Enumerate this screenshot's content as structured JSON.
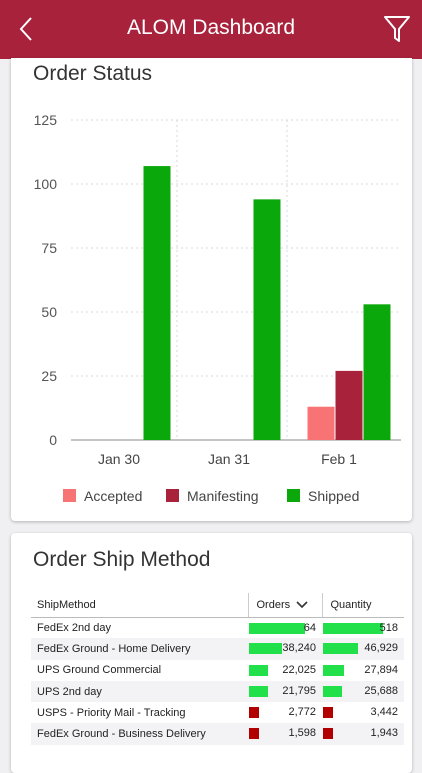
{
  "header": {
    "title": "ALOM Dashboard"
  },
  "order_status": {
    "title": "Order Status"
  },
  "ship_method": {
    "title": "Order Ship Method",
    "columns": [
      "ShipMethod",
      "Orders",
      "Quantity"
    ],
    "rows": [
      {
        "method": "FedEx 2nd day",
        "orders": "64",
        "quantity": "518",
        "orders_val": 64000,
        "qty_val": 80000
      },
      {
        "method": "FedEx Ground - Home Delivery",
        "orders": "38,240",
        "quantity": "46,929",
        "orders_val": 38240,
        "qty_val": 46929
      },
      {
        "method": "UPS Ground Commercial",
        "orders": "22,025",
        "quantity": "27,894",
        "orders_val": 22025,
        "qty_val": 27894
      },
      {
        "method": "UPS 2nd day",
        "orders": "21,795",
        "quantity": "25,688",
        "orders_val": 21795,
        "qty_val": 25688
      },
      {
        "method": "USPS - Priority Mail - Tracking",
        "orders": "2,772",
        "quantity": "3,442",
        "orders_val": 2772,
        "qty_val": 3442
      },
      {
        "method": "FedEx Ground - Business Delivery",
        "orders": "1,598",
        "quantity": "1,943",
        "orders_val": 1598,
        "qty_val": 1943
      }
    ]
  },
  "colors": {
    "header": "#a8223c",
    "accepted": "#f87474",
    "manifesting": "#a8223c",
    "shipped": "#0aa80a",
    "bar_green": "#22e04a",
    "bar_red": "#b20000"
  },
  "chart_data": {
    "type": "bar",
    "categories": [
      "Jan 30",
      "Jan 31",
      "Feb 1"
    ],
    "series": [
      {
        "name": "Accepted",
        "values": [
          0,
          0,
          13
        ]
      },
      {
        "name": "Manifesting",
        "values": [
          0,
          0,
          27
        ]
      },
      {
        "name": "Shipped",
        "values": [
          107,
          94,
          53
        ]
      }
    ],
    "yticks": [
      "0",
      "25",
      "50",
      "75",
      "100",
      "125"
    ],
    "ylim": [
      0,
      125
    ],
    "grid": true,
    "legend": "bottom"
  }
}
